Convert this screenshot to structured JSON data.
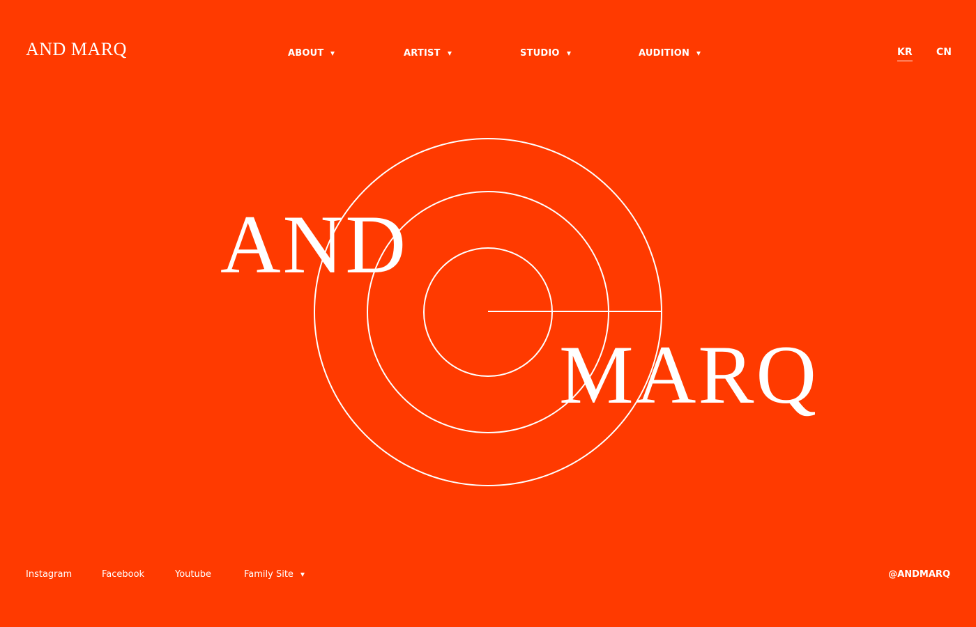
{
  "brand": {
    "logo_text": "AND MARQ",
    "background_color": "#ff3a00",
    "foreground_color": "#ffffff"
  },
  "nav": {
    "items": [
      {
        "label": "ABOUT",
        "icon": "caret-down-icon"
      },
      {
        "label": "ARTIST",
        "icon": "caret-down-icon"
      },
      {
        "label": "STUDIO",
        "icon": "caret-down-icon"
      },
      {
        "label": "AUDITION",
        "icon": "caret-down-icon"
      }
    ]
  },
  "languages": [
    {
      "label": "KR",
      "active": true
    },
    {
      "label": "CN",
      "active": false
    }
  ],
  "hero": {
    "word_top": "AND",
    "word_bottom": "MARQ"
  },
  "footer": {
    "links": [
      {
        "label": "Instagram"
      },
      {
        "label": "Facebook"
      },
      {
        "label": "Youtube"
      },
      {
        "label": "Family Site",
        "icon": "caret-down-icon"
      }
    ],
    "handle": "@ANDMARQ"
  }
}
